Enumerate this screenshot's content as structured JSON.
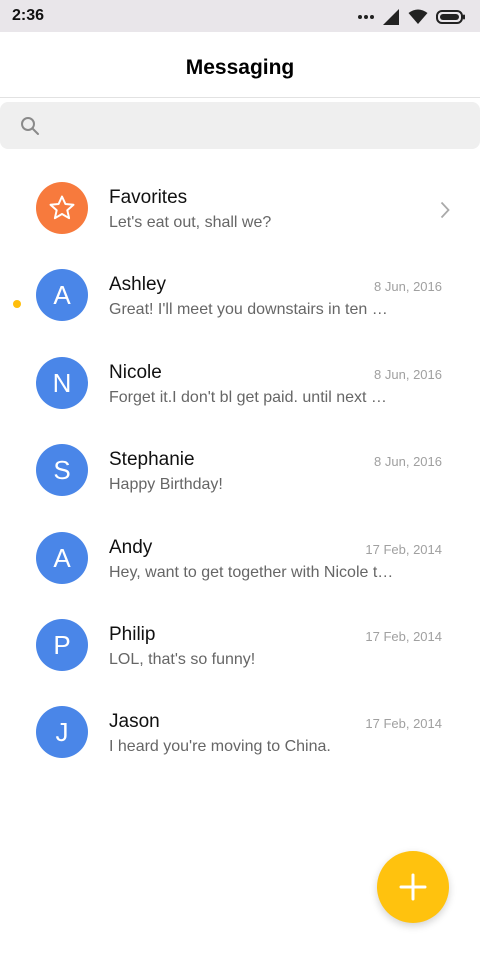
{
  "status_bar": {
    "time": "2:36",
    "icons": [
      "more-dots-icon",
      "signal-icon",
      "wifi-icon",
      "battery-icon"
    ]
  },
  "app_bar": {
    "title": "Messaging"
  },
  "search": {
    "icon": "search-icon"
  },
  "conversations": [
    {
      "name": "Favorites",
      "preview": "Let's eat out, shall we?",
      "avatar_icon": "star-icon",
      "avatar_color": "#f77a3d",
      "trailing_icon": "chevron-right-icon"
    },
    {
      "name": "Ashley",
      "initial": "A",
      "preview": "Great! I'll meet you downstairs in ten minutes.",
      "date": "8 Jun, 2016",
      "avatar_color": "#4a86e8"
    },
    {
      "name": "Nicole",
      "initial": "N",
      "preview": "Forget it.I don't bl get paid. until next week.",
      "date": "8 Jun, 2016",
      "avatar_color": "#4a86e8"
    },
    {
      "name": "Stephanie",
      "initial": "S",
      "preview": "Happy Birthday!",
      "date": "8 Jun, 2016",
      "avatar_color": "#4a86e8",
      "unread": true
    },
    {
      "name": "Andy",
      "initial": "A",
      "preview": "Hey, want to get together with Nicole tonight?",
      "date": "17 Feb, 2014",
      "avatar_color": "#4a86e8"
    },
    {
      "name": "Philip",
      "initial": "P",
      "preview": "LOL, that's so funny!",
      "date": "17 Feb, 2014",
      "avatar_color": "#4a86e8"
    },
    {
      "name": "Jason",
      "initial": "J",
      "preview": "I heard you're moving to China.",
      "date": "17 Feb, 2014",
      "avatar_color": "#4a86e8"
    }
  ],
  "colors": {
    "unread_dot": "#ffbe0b",
    "fab": "#ffc20e"
  },
  "fab": {
    "icon": "plus-icon"
  }
}
